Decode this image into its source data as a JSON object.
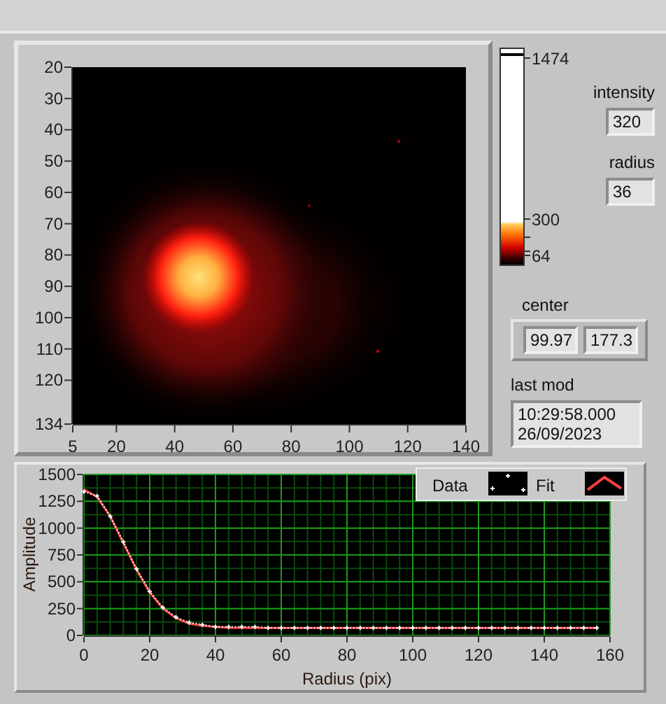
{
  "image_graph": {
    "x_ticks": [
      "5",
      "20",
      "40",
      "60",
      "80",
      "100",
      "120",
      "140"
    ],
    "y_ticks": [
      "20",
      "30",
      "40",
      "50",
      "60",
      "70",
      "80",
      "90",
      "100",
      "110",
      "120",
      "134"
    ]
  },
  "color_scale": {
    "max": "1474",
    "mid": "300",
    "min": "64"
  },
  "indicators": [
    {
      "label": "intensity",
      "value": "320"
    },
    {
      "label": "radius",
      "value": "36"
    }
  ],
  "center": {
    "label": "center",
    "values": [
      "99.97",
      "177.3"
    ]
  },
  "last_mod": {
    "label": "last mod",
    "value": "10:29:58.000\n26/09/2023"
  },
  "profile_chart": {
    "chart_data": {
      "type": "line",
      "xlabel": "Radius (pix)",
      "ylabel": "Amplitude",
      "x": [
        0,
        4,
        8,
        12,
        16,
        20,
        24,
        28,
        32,
        36,
        40,
        44,
        48,
        52,
        56,
        60,
        64,
        68,
        72,
        76,
        80,
        84,
        88,
        92,
        96,
        100,
        104,
        108,
        112,
        116,
        120,
        124,
        128,
        132,
        136,
        140,
        144,
        148,
        152,
        156
      ],
      "series": [
        {
          "name": "Fit",
          "color": "#ff4040",
          "values": [
            1360,
            1290,
            1110,
            860,
            610,
            400,
            250,
            160,
            110,
            90,
            80,
            70,
            70,
            70,
            70,
            70,
            70,
            70,
            70,
            70,
            70,
            70,
            70,
            70,
            70,
            70,
            70,
            70,
            70,
            70,
            70,
            70,
            70,
            70,
            70,
            70,
            70,
            70,
            70,
            70
          ]
        },
        {
          "name": "Data",
          "color": "#ffffff",
          "marker": "cross",
          "line_style": "dotted",
          "values": [
            1340,
            1300,
            1110,
            870,
            620,
            410,
            260,
            170,
            120,
            100,
            80,
            80,
            80,
            80,
            70,
            70,
            70,
            70,
            70,
            70,
            70,
            70,
            70,
            70,
            70,
            70,
            70,
            70,
            70,
            70,
            70,
            70,
            70,
            70,
            70,
            70,
            70,
            70,
            70,
            70
          ]
        }
      ],
      "grid": true,
      "legend": "top-right",
      "xlim": [
        0,
        160
      ],
      "ylim": [
        0,
        1500
      ],
      "xticks": [
        0,
        20,
        40,
        60,
        80,
        100,
        120,
        140,
        160
      ],
      "yticks": [
        0,
        250,
        500,
        750,
        1000,
        1250,
        1500
      ]
    }
  }
}
